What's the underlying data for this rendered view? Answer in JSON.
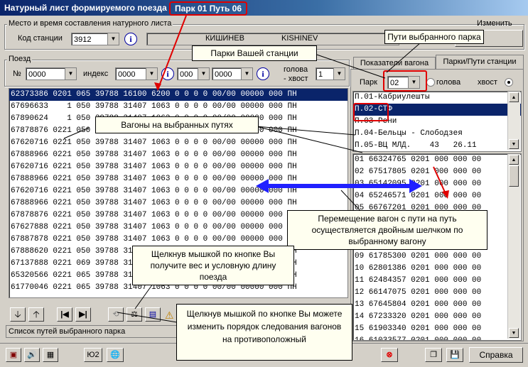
{
  "window": {
    "title": "Натурный лист формируемого поезда",
    "park_path": "Парк 01  Путь 06"
  },
  "place_group": {
    "title": "Место и время составления натурного листа",
    "station_label": "Код  станции",
    "station_code": "3912",
    "station_ru": "КИШИНЕВ",
    "station_en": "KISHINEV",
    "change_label": "Изменить"
  },
  "train_group": {
    "title": "Поезд",
    "no_label": "№",
    "no_value": "0000",
    "index_label": "индекс",
    "index_1": "0000",
    "index_2": "000",
    "index_3": "0000",
    "head_label": "голова",
    "tail_label": "- хвост",
    "head_tail_value": "1"
  },
  "wagons": [
    "62373386 0201 065 39788 16100 6200 0 0 0 0 00/00 00000 000 ПН",
    "67696633    1 050 39788 31407 1063 0 0 0 0 00/00 00000 000 ПН",
    "67890624    1 050 39788 31407 1063 0 0 0 0 00/00 00000 000 ПН",
    "67878876 0221 050 39788 31407 1063 0 0 0 0 00/00 00000 000 ПН",
    "67620716 0221 050 39788 31407 1063 0 0 0 0 00/00 00000 000 ПН",
    "67888966 0221 050 39788 31407 1063 0 0 0 0 00/00 00000 000 ПН",
    "67620716 0221 050 39788 31407 1063 0 0 0 0 00/00 00000 000 ПН",
    "67888966 0221 050 39788 31407 1063 0 0 0 0 00/00 00000 000 ПН",
    "67620716 0221 050 39788 31407 1063 0 0 0 0 00/00 00000 000 ПН",
    "67888966 0221 050 39788 31407 1063 0 0 0 0 00/00 00000 000 ПН",
    "67878876 0221 050 39788 31407 1063 0 0 0 0 00/00 00000 000 ПН",
    "67627888 0221 050 39788 31407 1063 0 0 0 0 00/00 00000 000 ПН",
    "67887878 0221 050 39788 31407 1063 0 0 0 0 00/00 00000 000 ПН",
    "67888620 0221 050 39788 31407 1063 0 0 0 0 00/00 00000 000 ПН",
    "67137888 0221 069 39788 31407 1063 0 0 0 0 00/00 00000 000 ПН",
    "65320566 0221 065 39788 31407 1063 0 0 0 0 00/00 00000 000 ПН",
    "61770046 0221 065 39788 31407 1063 0 0 0 0 00/00 00000 000 ПН"
  ],
  "status": {
    "paths_list_label": "Список путей выбранного парка"
  },
  "bottom": {
    "version_label": "Ю2",
    "help_label": "Справка"
  },
  "right_panel": {
    "tab_indicators": "Показатели вагона",
    "tab_parks": "Парки/Пути станции",
    "park_label": "Парк",
    "park_value": "02",
    "radio_head": "голова",
    "radio_tail": "хвост",
    "paths": [
      "П.01-Кабриулешты",
      "П.02-СТФ",
      "П.03-Рени",
      "П.04-Бельцы - Слободзея",
      "П.05-ВЦ МЛД.    43   26.11"
    ],
    "park_wagons": [
      "01 66324765 0201 000 000 00",
      "02 67517805 0201 000 000 00",
      "03 65142095 0201 000 000 00",
      "04 65246571 0201 000 000 00",
      "05 66767201 0201 000 000 00",
      "06 67311587 0201 000 000 00",
      "07 67310522 0201 000 000 00",
      "08 67518033 0201 000 000 00",
      "09 61785300 0201 000 000 00",
      "10 62801386 0201 000 000 00",
      "11 62484357 0201 000 000 00",
      "12 66147075 0201 000 000 00",
      "13 67645804 0201 000 000 00",
      "14 67233320 0201 000 000 00",
      "15 61903340 0201 000 000 00",
      "16 61033577 0201 000 000 00",
      "17 67807230 0201 000 000 00",
      "18 61807231 0201 000 000 00",
      "19 67302105 0201 000 000 00"
    ]
  },
  "callouts": {
    "paths_selected_park": "Пути выбранного парка",
    "parks_station": "Парки Вашей станции",
    "wagons_on_paths": "Вагоны на выбранных  путях",
    "move_wagons": "Перемещение вагон с пути на путь осуществляется двойным шелчком по выбранному вагону",
    "weight_button": "Щелкнув мышкой по кнопке Вы получите вес и условную длину поезда",
    "reverse_button": "Щелкнув мышкой по кнопке Вы можете изменить порядок следования вагонов на  противоположный"
  },
  "colors": {
    "title_bg": "#0a246a",
    "callout_line": "#e00000",
    "arrow": "#2020ff",
    "selection": "#0a246a"
  }
}
